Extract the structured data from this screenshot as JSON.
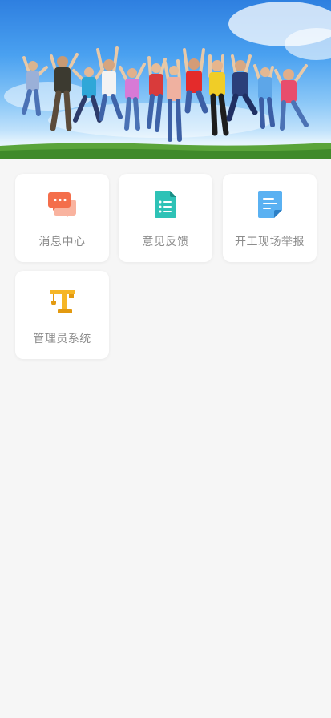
{
  "banner": {
    "image": "jumping-people-banner"
  },
  "menu": {
    "items": [
      {
        "label": "消息中心",
        "icon": "chat-bubbles-icon",
        "color": "#f46e4b"
      },
      {
        "label": "意见反馈",
        "icon": "feedback-document-icon",
        "color": "#2ec2b6"
      },
      {
        "label": "开工现场举报",
        "icon": "report-document-icon",
        "color": "#5ab1f2"
      },
      {
        "label": "管理员系统",
        "icon": "tower-crane-icon",
        "color": "#f6b626"
      }
    ]
  }
}
